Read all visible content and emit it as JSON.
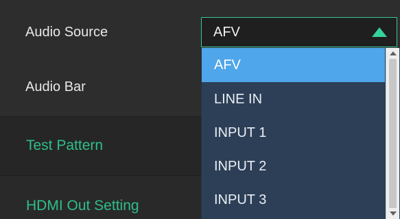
{
  "settings": {
    "audio_source_label": "Audio Source",
    "audio_bar_label": "Audio Bar",
    "test_pattern_label": "Test Pattern",
    "hdmi_out_label": "HDMI Out Setting"
  },
  "audio_source_select": {
    "value": "AFV",
    "options": [
      "AFV",
      "LINE IN",
      "INPUT 1",
      "INPUT 2",
      "INPUT 3"
    ],
    "selected_index": 0
  },
  "colors": {
    "accent": "#2fbf8a",
    "selected_option": "#4fa6ea",
    "dropdown_bg": "#2d3f57"
  }
}
